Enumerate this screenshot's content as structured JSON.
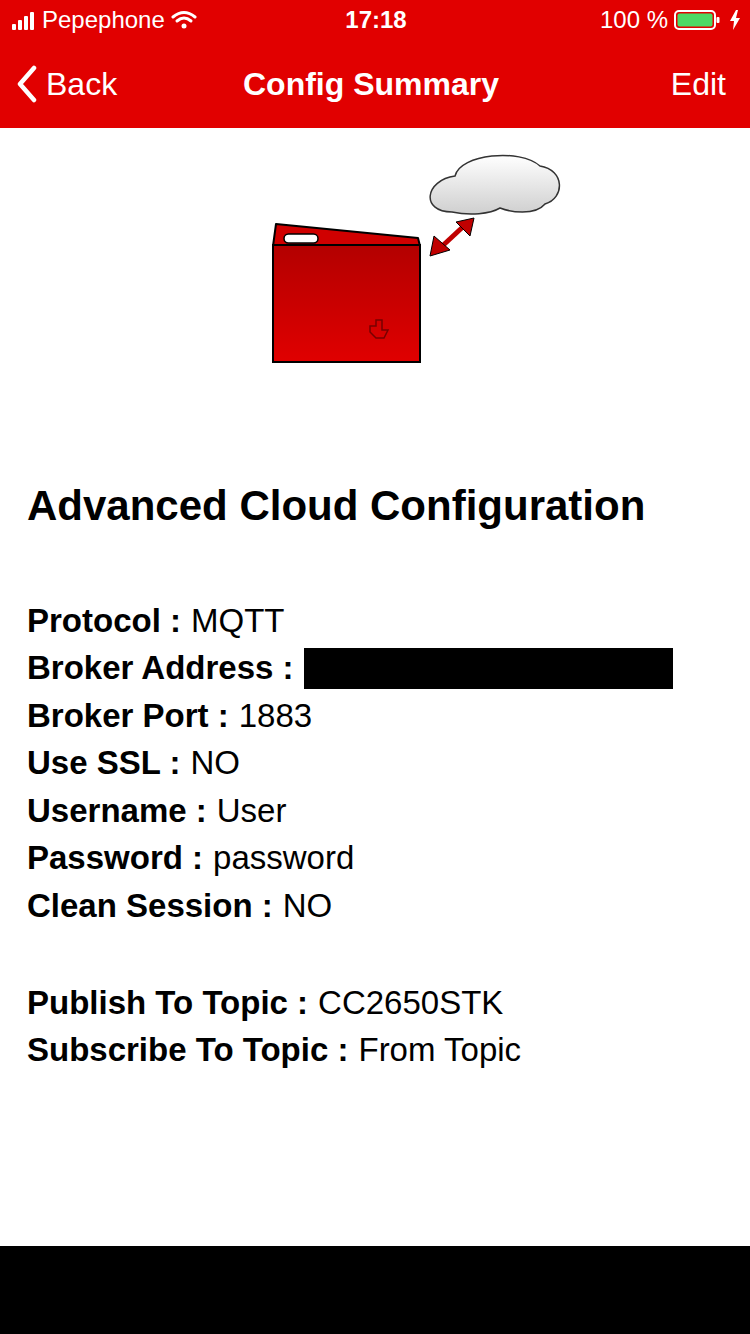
{
  "status_bar": {
    "carrier": "Pepephone",
    "signal_level": 1,
    "wifi": true,
    "time": "17:18",
    "battery": "100 %",
    "battery_level": 1,
    "charging": true
  },
  "nav": {
    "back": "Back",
    "title": "Config Summary",
    "action": "Edit"
  },
  "heading": "Advanced Cloud Configuration",
  "settings": [
    {
      "label": "Protocol :",
      "value": "MQTT",
      "redacted": false
    },
    {
      "label": "Broker Address :",
      "value": "",
      "redacted": true
    },
    {
      "label": "Broker Port :",
      "value": "1883",
      "redacted": false
    },
    {
      "label": "Use SSL :",
      "value": "NO",
      "redacted": false
    },
    {
      "label": "Username :",
      "value": "User",
      "redacted": false
    },
    {
      "label": "Password :",
      "value": "password",
      "redacted": false
    },
    {
      "label": "Clean Session :",
      "value": "NO",
      "redacted": false
    }
  ],
  "topics": [
    {
      "label": "Publish To Topic :",
      "value": "CC2650STK"
    },
    {
      "label": "Subscribe To Topic :",
      "value": "From Topic"
    }
  ]
}
